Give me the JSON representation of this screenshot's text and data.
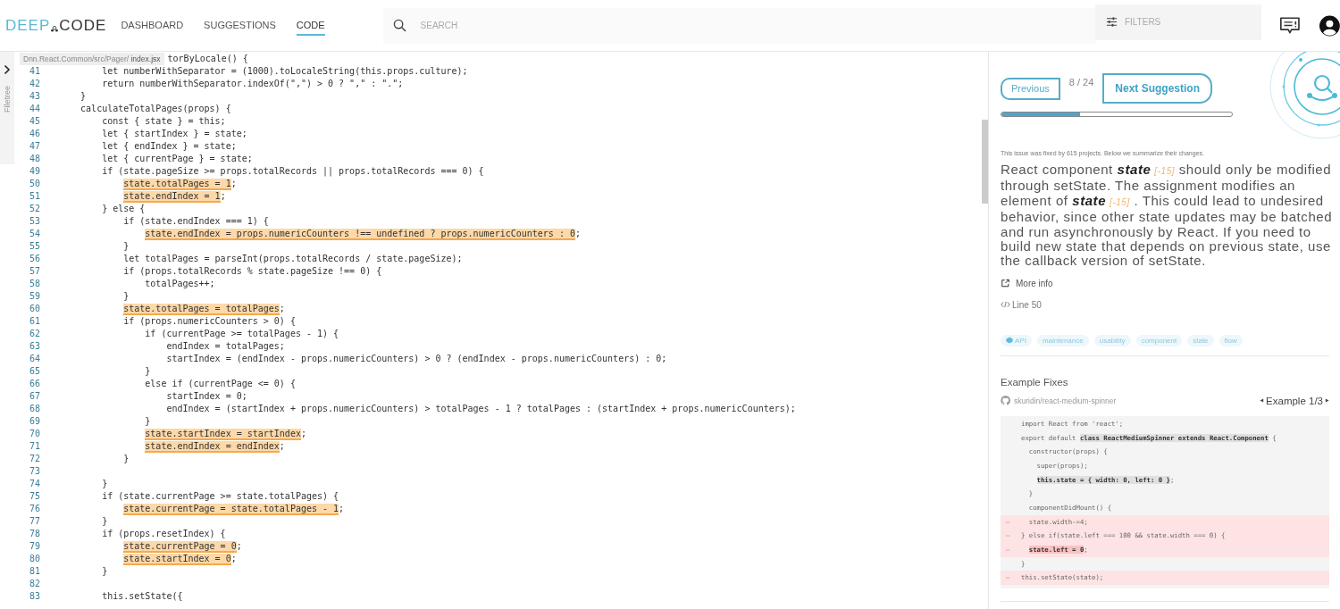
{
  "header": {
    "logo": {
      "first": "DEEP",
      "second": "CODE"
    },
    "nav": [
      {
        "label": "DASHBOARD",
        "selected": false
      },
      {
        "label": "SUGGESTIONS",
        "selected": false
      },
      {
        "label": "CODE",
        "selected": true
      }
    ],
    "search": {
      "placeholder": "SEARCH"
    },
    "filters": {
      "placeholder": "FILTERS"
    }
  },
  "editor": {
    "filetree_label": "Filetree",
    "breadcrumb": {
      "path": "Dnn.React.Common/src/Pager/",
      "file": "index.jsx"
    },
    "lines": [
      {
        "code": "torByLocale() {"
      },
      {
        "number": "41",
        "code": "        let numberWithSeparator = (1000).toLocaleString(this.props.culture);"
      },
      {
        "number": "42",
        "code": "        return numberWithSeparator.indexOf(\",\") > 0 ? \",\" : \".\";"
      },
      {
        "number": "43",
        "code": "    }"
      },
      {
        "number": "44",
        "code": "    calculateTotalPages(props) {"
      },
      {
        "number": "45",
        "code": "        const { state } = this;"
      },
      {
        "number": "46",
        "code": "        let { startIndex } = state;"
      },
      {
        "number": "47",
        "code": "        let { endIndex } = state;"
      },
      {
        "number": "48",
        "code": "        let { currentPage } = state;"
      },
      {
        "number": "49",
        "code": "        if (state.pageSize >= props.totalRecords || props.totalRecords === 0) {"
      },
      {
        "number": "50",
        "highlight": "            state.totalPages = 1",
        "after": ";"
      },
      {
        "number": "51",
        "highlight": "            state.endIndex = 1",
        "after": ";"
      },
      {
        "number": "52",
        "code": "        } else {"
      },
      {
        "number": "53",
        "code": "            if (state.endIndex === 1) {"
      },
      {
        "number": "54",
        "highlight": "                state.endIndex = props.numericCounters !== undefined ? props.numericCounters : 0",
        "after": ";"
      },
      {
        "number": "55",
        "code": "            }"
      },
      {
        "number": "56",
        "code": "            let totalPages = parseInt(props.totalRecords / state.pageSize);"
      },
      {
        "number": "57",
        "code": "            if (props.totalRecords % state.pageSize !== 0) {"
      },
      {
        "number": "58",
        "code": "                totalPages++;"
      },
      {
        "number": "59",
        "code": "            }"
      },
      {
        "number": "60",
        "highlight": "            state.totalPages = totalPages",
        "after": ";"
      },
      {
        "number": "61",
        "code": "            if (props.numericCounters > 0) {"
      },
      {
        "number": "62",
        "code": "                if (currentPage >= totalPages - 1) {"
      },
      {
        "number": "63",
        "code": "                    endIndex = totalPages;"
      },
      {
        "number": "64",
        "code": "                    startIndex = (endIndex - props.numericCounters) > 0 ? (endIndex - props.numericCounters) : 0;"
      },
      {
        "number": "65",
        "code": "                }"
      },
      {
        "number": "66",
        "code": "                else if (currentPage <= 0) {"
      },
      {
        "number": "67",
        "code": "                    startIndex = 0;"
      },
      {
        "number": "68",
        "code": "                    endIndex = (startIndex + props.numericCounters) > totalPages - 1 ? totalPages : (startIndex + props.numericCounters);"
      },
      {
        "number": "69",
        "code": "                }"
      },
      {
        "number": "70",
        "highlight": "                state.startIndex = startIndex",
        "after": ";"
      },
      {
        "number": "71",
        "highlight": "                state.endIndex = endIndex",
        "after": ";"
      },
      {
        "number": "72",
        "code": "            }"
      },
      {
        "number": "73"
      },
      {
        "number": "74",
        "code": "        }"
      },
      {
        "number": "75",
        "code": "        if (state.currentPage >= state.totalPages) {"
      },
      {
        "number": "76",
        "highlight": "            state.currentPage = state.totalPages - 1",
        "after": ";"
      },
      {
        "number": "77",
        "code": "        }"
      },
      {
        "number": "78",
        "code": "        if (props.resetIndex) {"
      },
      {
        "number": "79",
        "highlight": "            state.currentPage = 0",
        "after": ";"
      },
      {
        "number": "80",
        "highlight": "            state.startIndex = 0",
        "after": ";"
      },
      {
        "number": "81",
        "code": "        }"
      },
      {
        "number": "82"
      },
      {
        "number": "83",
        "code": "        this.setState({"
      }
    ]
  },
  "suggestion": {
    "previous": "Previous",
    "counter": "8 / 24",
    "next": "Next Suggestion",
    "level": 0.34,
    "summary": "This issue was fixed by 615 projects. Below we summarize their changes.",
    "description": [
      {
        "text": "React component ",
        "kind": "plain"
      },
      {
        "text": "state",
        "kind": "keyword"
      },
      {
        "text": "[-15]",
        "kind": "ref"
      },
      {
        "text": " should only be modified through setState. The assignment modifies an element of ",
        "kind": "plain"
      },
      {
        "text": "state",
        "kind": "keyword"
      },
      {
        "text": "[-15]",
        "kind": "ref"
      },
      {
        "text": " . This could lead to undesired behavior, since other state updates may be batched and run asynchronously by React. If you need to build new state that depends on previous state, use the callback version of setState.",
        "kind": "plain"
      }
    ],
    "more_info": "More info",
    "line_ref": "Line 50",
    "tags": [
      {
        "label": "API",
        "icon": true
      },
      {
        "label": "maintenance",
        "icon": false
      },
      {
        "label": "usability",
        "icon": false
      },
      {
        "label": "component",
        "icon": false
      },
      {
        "label": "state",
        "icon": false
      },
      {
        "label": "flow",
        "icon": false
      }
    ]
  },
  "examples": {
    "title": "Example Fixes",
    "repo": "skuridin/react-medium-spinner",
    "pager": "Example 1/3",
    "lines": [
      {
        "kind": "context",
        "code": "import React from 'react';"
      },
      {
        "kind": "context",
        "code": "export default ",
        "highlight": "class ReactMediumSpinner extends React.Component",
        "after": " {"
      },
      {
        "kind": "context",
        "code": "  constructor(props) {"
      },
      {
        "kind": "context",
        "code": "    super(props);"
      },
      {
        "kind": "context",
        "highlight": "    this.state = { width: 0, left: 0 }",
        "after": ";"
      },
      {
        "kind": "context",
        "code": "  }"
      },
      {
        "kind": "context",
        "code": "  componentDidMount() {"
      },
      {
        "kind": "removed",
        "sign": "–",
        "code": "  state.width-=4;"
      },
      {
        "kind": "removed",
        "sign": "–",
        "code": "} else if(state.left === 100 && state.width === 0) {"
      },
      {
        "kind": "removed",
        "sign": "–",
        "highlight": "  state.left = 0",
        "after": ";"
      },
      {
        "kind": "context",
        "code": "}"
      },
      {
        "kind": "removed",
        "sign": "–",
        "code": "this.setState(state);"
      }
    ]
  }
}
